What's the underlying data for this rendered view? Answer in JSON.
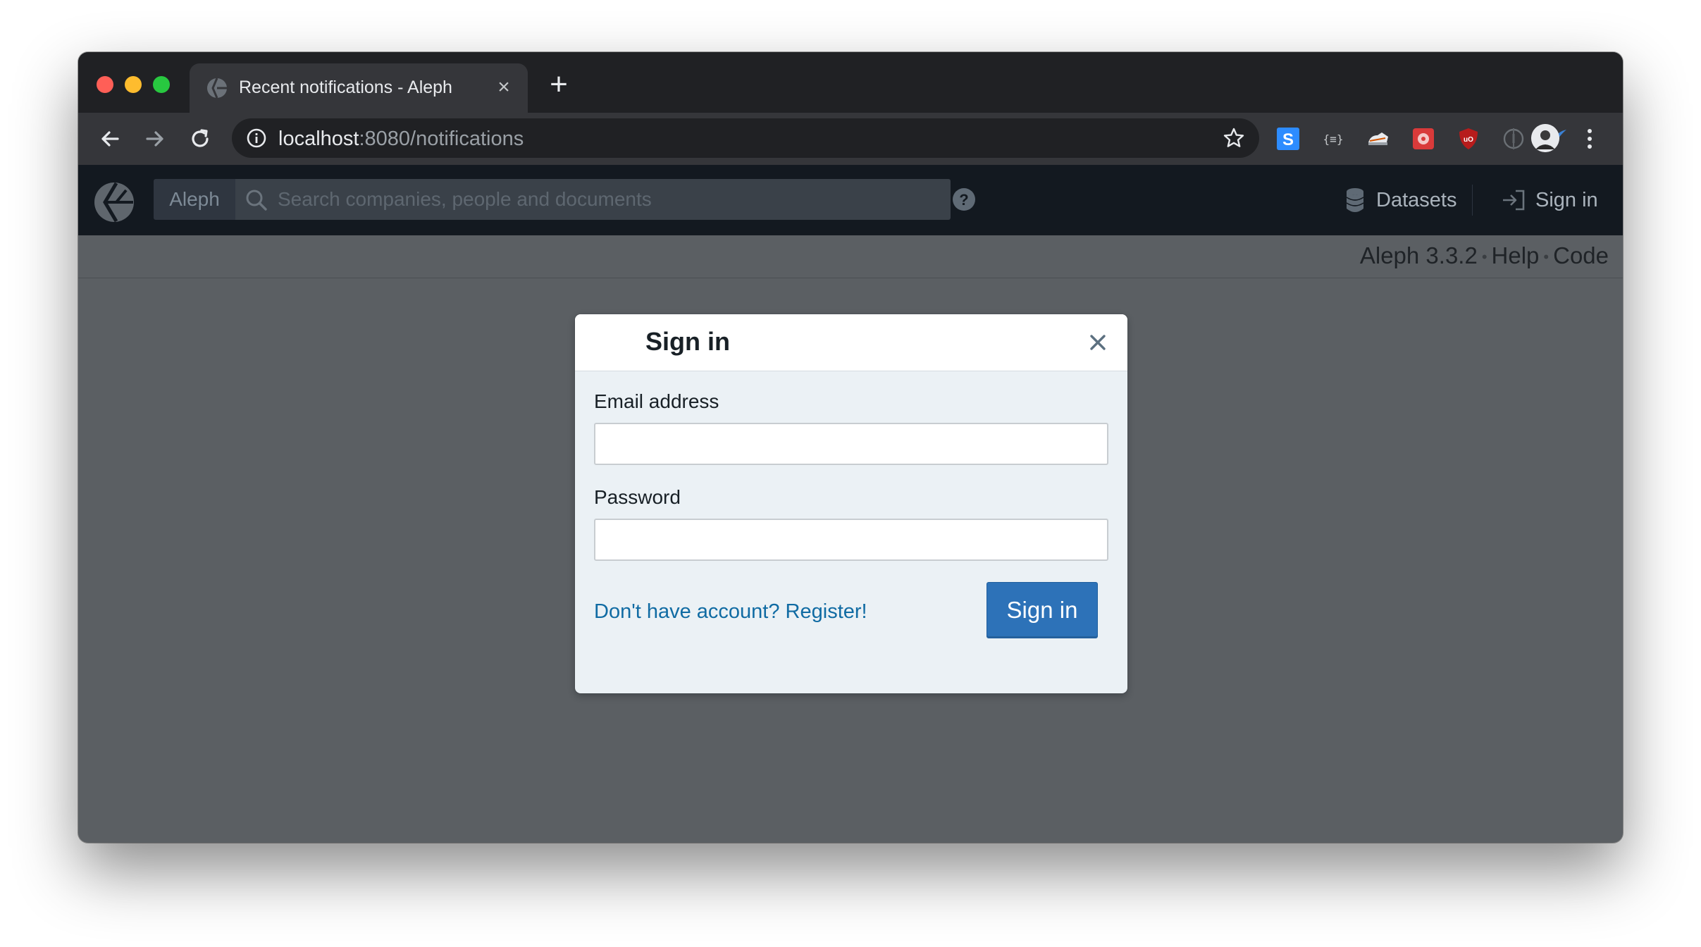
{
  "browser": {
    "tab_title": "Recent notifications - Aleph",
    "url_host": "localhost",
    "url_rest": ":8080/notifications"
  },
  "app": {
    "brand": "Aleph",
    "search_placeholder": "Search companies, people and documents",
    "nav_datasets": "Datasets",
    "nav_signin": "Sign in"
  },
  "version_bar": {
    "version": "Aleph 3.3.2",
    "help": "Help",
    "code": "Code"
  },
  "modal": {
    "title": "Sign in",
    "email_label": "Email address",
    "email_value": "",
    "password_label": "Password",
    "password_value": "",
    "register_link": "Don't have account? Register!",
    "submit_label": "Sign in"
  },
  "colors": {
    "app_nav_bg": "#131920",
    "backdrop": "#5b5f63",
    "primary_button": "#2d72b8",
    "link": "#106ba3"
  }
}
